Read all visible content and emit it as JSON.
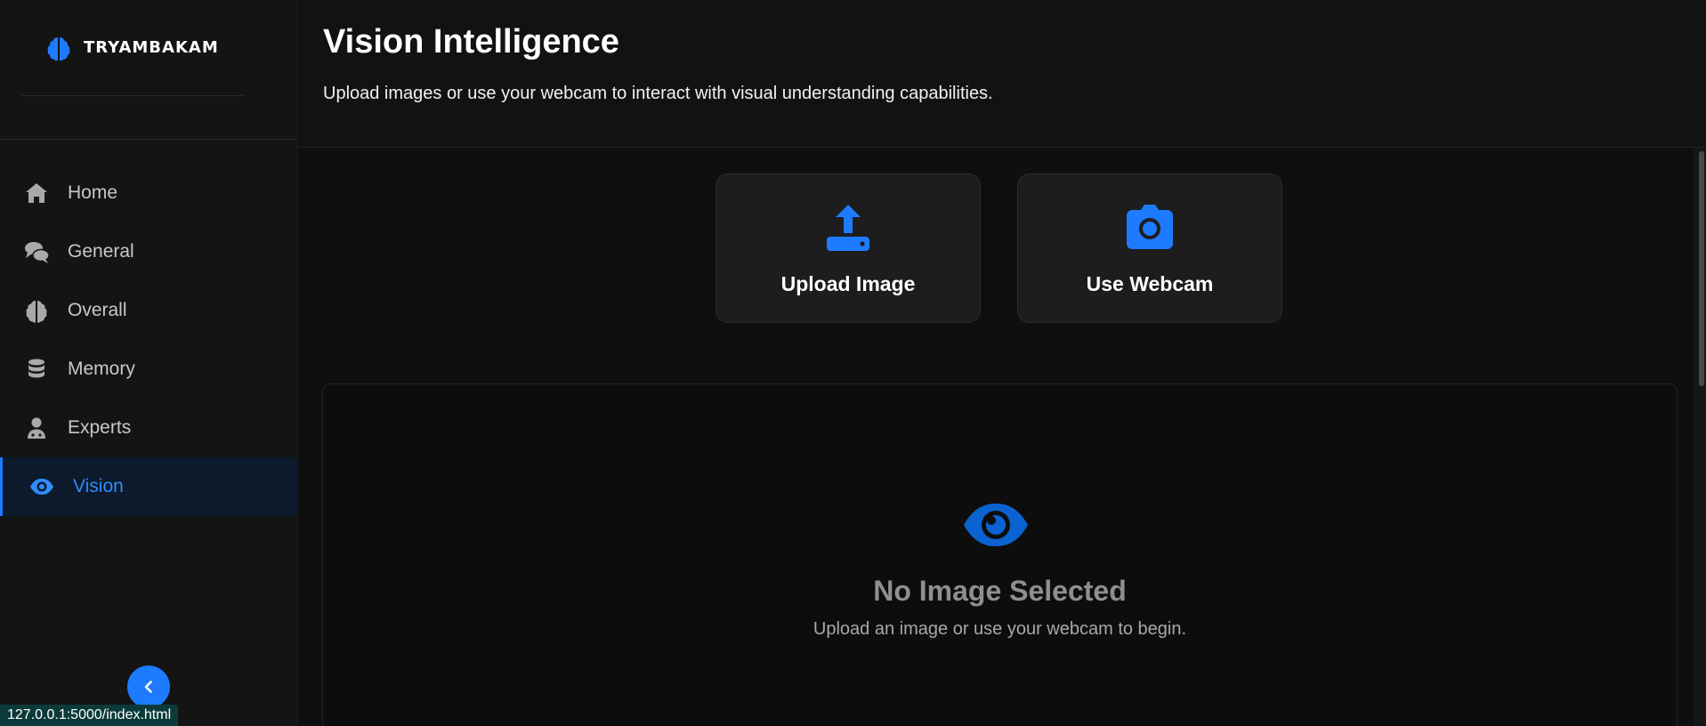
{
  "brand": {
    "name": "TRYAMBAKAM"
  },
  "sidebar": {
    "items": [
      {
        "label": "Home",
        "icon": "home-icon",
        "active": false
      },
      {
        "label": "General",
        "icon": "chat-icon",
        "active": false
      },
      {
        "label": "Overall",
        "icon": "brain-icon",
        "active": false
      },
      {
        "label": "Memory",
        "icon": "database-icon",
        "active": false
      },
      {
        "label": "Experts",
        "icon": "user-doctor-icon",
        "active": false
      },
      {
        "label": "Vision",
        "icon": "eye-icon",
        "active": true
      }
    ],
    "collapse_icon": "chevron-left-icon"
  },
  "header": {
    "title": "Vision Intelligence",
    "subtitle": "Upload images or use your webcam to interact with visual understanding capabilities."
  },
  "actions": {
    "upload_label": "Upload Image",
    "webcam_label": "Use Webcam"
  },
  "preview": {
    "title": "No Image Selected",
    "subtitle": "Upload an image or use your webcam to begin."
  },
  "status_bar": {
    "url": "127.0.0.1:5000/index.html"
  },
  "colors": {
    "accent": "#1e7bff",
    "active_bg": "#0c1a2b",
    "sidebar_bg": "#141415",
    "card_bg": "#1d1d1e"
  }
}
